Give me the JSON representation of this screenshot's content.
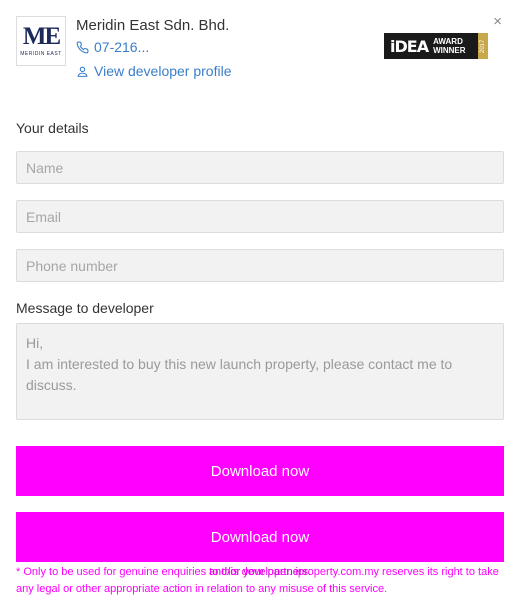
{
  "close_label": "×",
  "developer": {
    "logo_mark": "ME",
    "logo_sub": "MERIDIN EAST",
    "name": "Meridin East Sdn. Bhd.",
    "phone": "07-216...",
    "profile_link": "View developer profile"
  },
  "award": {
    "brand": "iDEA",
    "line1": "AWARD",
    "line2": "WINNER",
    "year": "2017"
  },
  "form": {
    "details_label": "Your details",
    "name_placeholder": "Name",
    "email_placeholder": "Email",
    "phone_placeholder": "Phone number",
    "message_label": "Message to developer",
    "message_value": "Hi,\nI am interested to buy this new launch property, please contact me to discuss."
  },
  "buttons": {
    "primary": "Download now",
    "secondary": "Download now"
  },
  "hidden_text": "and/or your partners.",
  "disclaimer": "* Only to be used for genuine enquiries to this developer. iproperty.com.my reserves its right to take any legal or other appropriate action in relation to any misuse of this service.",
  "colors": {
    "accent": "#ff00ff",
    "link": "#3a7ec9"
  }
}
